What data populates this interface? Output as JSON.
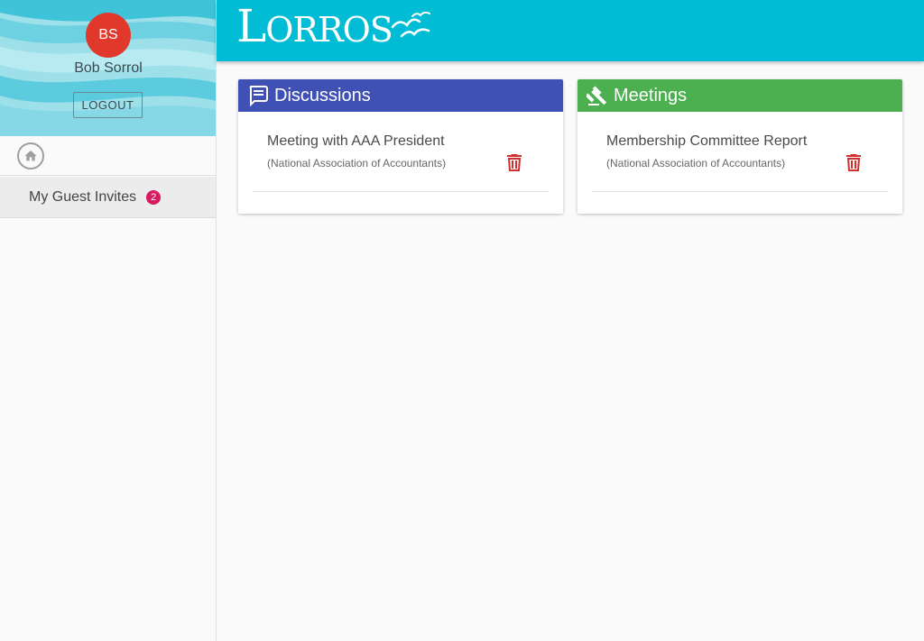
{
  "sidebar": {
    "avatar_initials": "BS",
    "user_name": "Bob Sorrol",
    "logout_label": "LOGOUT",
    "home_icon": "home-icon",
    "items": [
      {
        "label": "My Guest Invites",
        "badge": "2"
      }
    ]
  },
  "header": {
    "logo_text": "LORROS",
    "logo_icon": "seagulls-icon",
    "background": "#00bcd4"
  },
  "main": {
    "cards": [
      {
        "title": "Discussions",
        "icon": "discussion-icon",
        "color": "#3f51b5",
        "items": [
          {
            "title": "Meeting with AAA President",
            "subtitle": "(National Association of Accountants)",
            "action_icon": "delete-icon"
          }
        ]
      },
      {
        "title": "Meetings",
        "icon": "gavel-icon",
        "color": "#4caf50",
        "items": [
          {
            "title": "Membership Committee Report",
            "subtitle": "(National Association of Accountants)",
            "action_icon": "delete-icon"
          }
        ]
      }
    ]
  },
  "colors": {
    "avatar": "#e0392b",
    "badge": "#d81b60",
    "delete": "#d32f2f"
  }
}
